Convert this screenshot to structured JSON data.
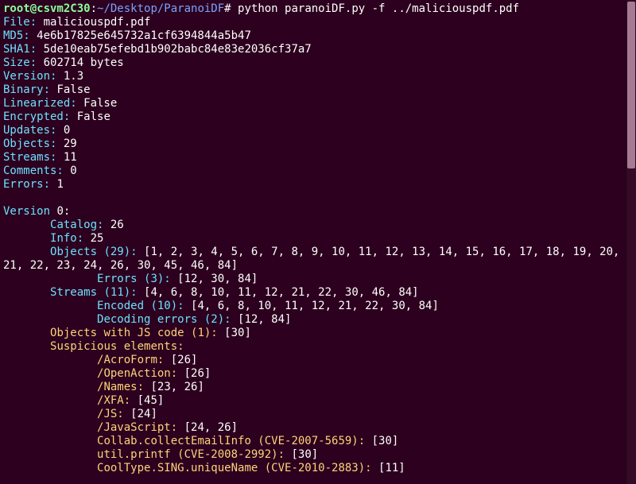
{
  "prompt": {
    "user": "root@csvm2C30",
    "sep1": ":",
    "path": "~/Desktop/ParanoiDF",
    "hash": "#",
    "command": " python paranoiDF.py -f ../maliciouspdf.pdf"
  },
  "header": {
    "file": {
      "label": "File:",
      "value": " maliciouspdf.pdf"
    },
    "md5": {
      "label": "MD5:",
      "value": " 4e6b17825e645732a1cf6394844a5b47"
    },
    "sha1": {
      "label": "SHA1:",
      "value": " 5de10eab75efebd1b902babc84e83e2036cf37a7"
    },
    "size": {
      "label": "Size:",
      "value": " 602714 bytes"
    },
    "version": {
      "label": "Version:",
      "value": " 1.3"
    },
    "binary": {
      "label": "Binary:",
      "value": " False"
    },
    "linearized": {
      "label": "Linearized:",
      "value": " False"
    },
    "encrypted": {
      "label": "Encrypted:",
      "value": " False"
    },
    "updates": {
      "label": "Updates:",
      "value": " 0"
    },
    "objects": {
      "label": "Objects:",
      "value": " 29"
    },
    "streams": {
      "label": "Streams:",
      "value": " 11"
    },
    "comments": {
      "label": "Comments:",
      "value": " 0"
    },
    "errors": {
      "label": "Errors:",
      "value": " 1"
    }
  },
  "vblock": {
    "heading": {
      "label": "Version",
      "value": " 0:"
    },
    "catalog": {
      "label": "Catalog:",
      "value": " 26"
    },
    "info": {
      "label": "Info:",
      "value": " 25"
    },
    "objects": {
      "label": "Objects (29):",
      "value": " [1, 2, 3, 4, 5, 6, 7, 8, 9, 10, 11, 12, 13, 14, 15, 16, 17, 18, 19, 20, 21, 22, 23, 24, 26, 30, 45, 46, 84]"
    },
    "errors": {
      "label": "Errors (3):",
      "value": " [12, 30, 84]"
    },
    "streams": {
      "label": "Streams (11):",
      "value": " [4, 6, 8, 10, 11, 12, 21, 22, 30, 46, 84]"
    },
    "encoded": {
      "label": "Encoded (10):",
      "value": " [4, 6, 8, 10, 11, 12, 21, 22, 30, 84]"
    },
    "decerr": {
      "label": "Decoding errors (2):",
      "value": " [12, 84]"
    },
    "jsobj": {
      "label": "Objects with JS code (1):",
      "value": " [30]"
    },
    "susp": {
      "label": "Suspicious elements:"
    },
    "acroform": {
      "label": "/AcroForm:",
      "value": " [26]"
    },
    "openaction": {
      "label": "/OpenAction:",
      "value": " [26]"
    },
    "names": {
      "label": "/Names:",
      "value": " [23, 26]"
    },
    "xfa": {
      "label": "/XFA:",
      "value": " [45]"
    },
    "js": {
      "label": "/JS:",
      "value": " [24]"
    },
    "javascript": {
      "label": "/JavaScript:",
      "value": " [24, 26]"
    },
    "collab": {
      "label": "Collab.collectEmailInfo (CVE-2007-5659):",
      "value": " [30]"
    },
    "util": {
      "label": "util.printf (CVE-2008-2992):",
      "value": " [30]"
    },
    "cooltype": {
      "label": "CoolType.SING.uniqueName (CVE-2010-2883):",
      "value": " [11]"
    }
  },
  "indent": {
    "i1": "       ",
    "i2": "              "
  }
}
